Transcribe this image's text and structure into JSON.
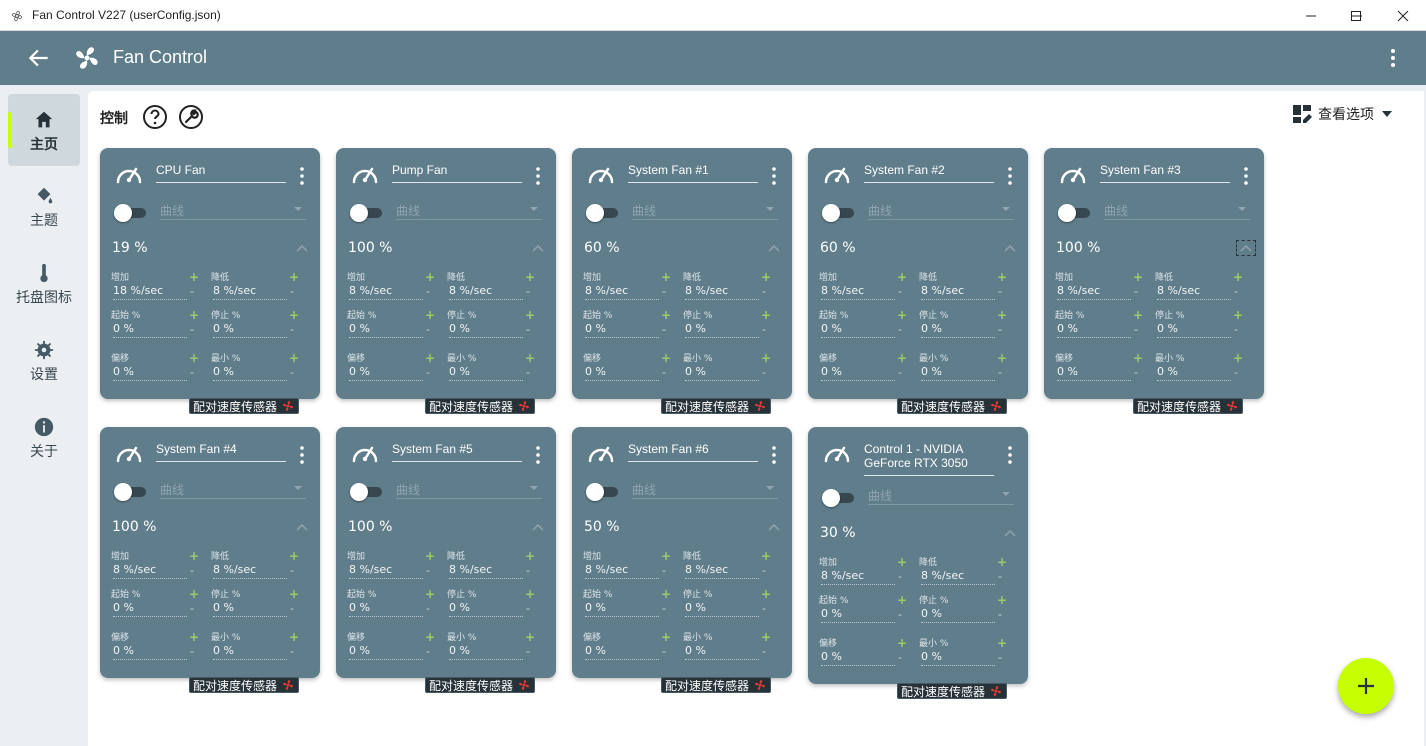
{
  "window": {
    "title": "Fan Control V227 (userConfig.json)",
    "minimize_icon": "minimize-icon",
    "maximize_icon": "maximize-icon",
    "close_icon": "close-icon"
  },
  "header": {
    "title": "Fan Control",
    "back_icon": "arrow-left-icon",
    "logo_icon": "fan-icon",
    "menu_icon": "more-vert-icon"
  },
  "sidebar": {
    "items": [
      {
        "label": "主页",
        "icon": "home-icon",
        "active": true
      },
      {
        "label": "主题",
        "icon": "paint-bucket-icon",
        "active": false
      },
      {
        "label": "托盘图标",
        "icon": "thermometer-icon",
        "active": false
      },
      {
        "label": "设置",
        "icon": "gear-icon",
        "active": false
      },
      {
        "label": "关于",
        "icon": "info-icon",
        "active": false
      }
    ]
  },
  "main": {
    "section_title": "控制",
    "view_options_label": "查看选项"
  },
  "labels": {
    "curve_placeholder": "曲线",
    "step_up": "增加",
    "step_down": "降低",
    "start": "起始 %",
    "stop": "停止 %",
    "offset": "偏移",
    "minimum": "最小 %",
    "pair_sensor": "配对速度传感器",
    "plus": "+",
    "minus": "-"
  },
  "cards": [
    {
      "name": "CPU Fan",
      "percent": "19 %",
      "step_up": "18 %/sec",
      "step_down": "8 %/sec",
      "start": "0 %",
      "stop": "0 %",
      "offset": "0 %",
      "minimum": "0 %"
    },
    {
      "name": "Pump Fan",
      "percent": "100 %",
      "step_up": "8 %/sec",
      "step_down": "8 %/sec",
      "start": "0 %",
      "stop": "0 %",
      "offset": "0 %",
      "minimum": "0 %"
    },
    {
      "name": "System Fan #1",
      "percent": "60 %",
      "step_up": "8 %/sec",
      "step_down": "8 %/sec",
      "start": "0 %",
      "stop": "0 %",
      "offset": "0 %",
      "minimum": "0 %"
    },
    {
      "name": "System Fan #2",
      "percent": "60 %",
      "step_up": "8 %/sec",
      "step_down": "8 %/sec",
      "start": "0 %",
      "stop": "0 %",
      "offset": "0 %",
      "minimum": "0 %"
    },
    {
      "name": "System Fan #3",
      "percent": "100 %",
      "step_up": "8 %/sec",
      "step_down": "8 %/sec",
      "start": "0 %",
      "stop": "0 %",
      "offset": "0 %",
      "minimum": "0 %"
    },
    {
      "name": "System Fan #4",
      "percent": "100 %",
      "step_up": "8 %/sec",
      "step_down": "8 %/sec",
      "start": "0 %",
      "stop": "0 %",
      "offset": "0 %",
      "minimum": "0 %"
    },
    {
      "name": "System Fan #5",
      "percent": "100 %",
      "step_up": "8 %/sec",
      "step_down": "8 %/sec",
      "start": "0 %",
      "stop": "0 %",
      "offset": "0 %",
      "minimum": "0 %"
    },
    {
      "name": "System Fan #6",
      "percent": "50 %",
      "step_up": "8 %/sec",
      "step_down": "8 %/sec",
      "start": "0 %",
      "stop": "0 %",
      "offset": "0 %",
      "minimum": "0 %"
    },
    {
      "name": "Control 1 - NVIDIA GeForce RTX 3050",
      "percent": "30 %",
      "step_up": "8 %/sec",
      "step_down": "8 %/sec",
      "start": "0 %",
      "stop": "0 %",
      "offset": "0 %",
      "minimum": "0 %"
    }
  ],
  "colors": {
    "header": "#607d8b",
    "card": "#607d8b",
    "accent": "#c6ff00",
    "plus": "#9ccc65",
    "pair_fan": "#e53935"
  },
  "fab": {
    "label": "+",
    "icon": "add-icon"
  }
}
